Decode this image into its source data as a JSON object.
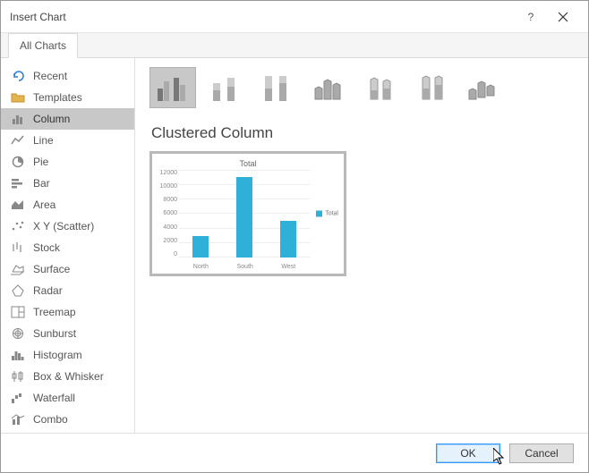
{
  "dialog": {
    "title": "Insert Chart",
    "help_tooltip": "?",
    "close_tooltip": "×"
  },
  "tabs": [
    {
      "label": "All Charts"
    }
  ],
  "sidebar": {
    "items": [
      {
        "label": "Recent",
        "icon": "undo-icon"
      },
      {
        "label": "Templates",
        "icon": "folder-icon"
      },
      {
        "label": "Column",
        "icon": "column-icon"
      },
      {
        "label": "Line",
        "icon": "line-icon"
      },
      {
        "label": "Pie",
        "icon": "pie-icon"
      },
      {
        "label": "Bar",
        "icon": "bar-icon"
      },
      {
        "label": "Area",
        "icon": "area-icon"
      },
      {
        "label": "X Y (Scatter)",
        "icon": "scatter-icon"
      },
      {
        "label": "Stock",
        "icon": "stock-icon"
      },
      {
        "label": "Surface",
        "icon": "surface-icon"
      },
      {
        "label": "Radar",
        "icon": "radar-icon"
      },
      {
        "label": "Treemap",
        "icon": "treemap-icon"
      },
      {
        "label": "Sunburst",
        "icon": "sunburst-icon"
      },
      {
        "label": "Histogram",
        "icon": "histogram-icon"
      },
      {
        "label": "Box & Whisker",
        "icon": "box-whisker-icon"
      },
      {
        "label": "Waterfall",
        "icon": "waterfall-icon"
      },
      {
        "label": "Combo",
        "icon": "combo-icon"
      }
    ],
    "selected_index": 2
  },
  "subtypes": [
    {
      "name": "clustered-column",
      "selected": true
    },
    {
      "name": "stacked-column",
      "selected": false
    },
    {
      "name": "100-stacked-column",
      "selected": false
    },
    {
      "name": "3d-clustered-column",
      "selected": false
    },
    {
      "name": "3d-stacked-column",
      "selected": false
    },
    {
      "name": "3d-100-stacked-column",
      "selected": false
    },
    {
      "name": "3d-column",
      "selected": false
    }
  ],
  "main": {
    "subtitle": "Clustered Column"
  },
  "chart_data": {
    "type": "bar",
    "title": "Total",
    "categories": [
      "North",
      "South",
      "West"
    ],
    "values": [
      3000,
      11000,
      5000
    ],
    "series": [
      {
        "name": "Total",
        "values": [
          3000,
          11000,
          5000
        ]
      }
    ],
    "ylim": [
      0,
      12000
    ],
    "yticks": [
      0,
      2000,
      4000,
      6000,
      8000,
      10000,
      12000
    ],
    "xlabel": "",
    "ylabel": "",
    "legend": "right"
  },
  "footer": {
    "ok": "OK",
    "cancel": "Cancel"
  },
  "colors": {
    "bar_fill": "#2eb0d8"
  }
}
